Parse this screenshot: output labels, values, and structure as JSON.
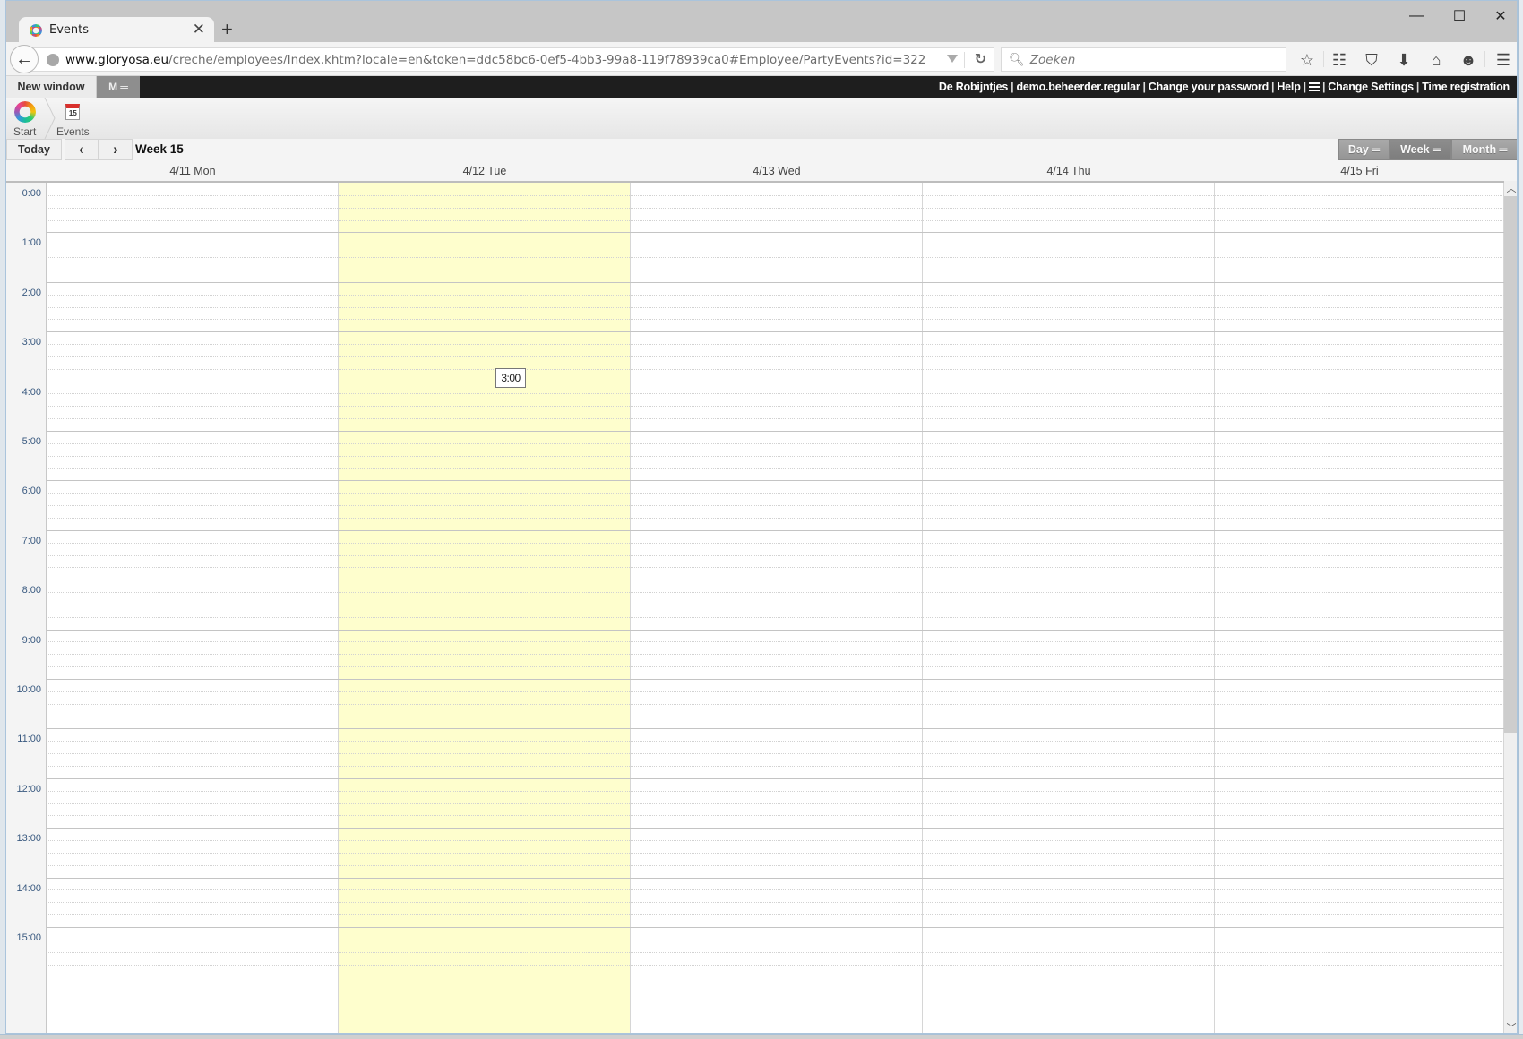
{
  "browser": {
    "tab_title": "Events",
    "url_domain": "www.gloryosa.eu",
    "url_path": "/creche/employees/Index.khtm?locale=en&token=ddc58bc6-0ef5-4bb3-99a8-119f78939ca0#Employee/PartyEvents?id=322",
    "search_placeholder": "Zoeken",
    "toolbar_icons": [
      "star-icon",
      "reading-list-icon",
      "pocket-icon",
      "download-icon",
      "home-icon",
      "smiley-icon",
      "hamburger-menu-icon"
    ]
  },
  "appbar": {
    "new_window_label": "New window",
    "m_label": "M ═",
    "links": {
      "org": "De Robijntjes",
      "user": "demo.beheerder.regular",
      "change_password": "Change your password",
      "help": "Help",
      "change_settings": "Change Settings",
      "time_registration": "Time registration"
    }
  },
  "breadcrumb": {
    "items": [
      {
        "label": "Start",
        "icon": "start-logo-icon"
      },
      {
        "label": "Events",
        "icon": "calendar-icon",
        "icon_text": "15"
      }
    ]
  },
  "calendar": {
    "today_label": "Today",
    "prev_label": "<",
    "next_label": ">",
    "title": "Week 15",
    "views": [
      {
        "label": "Day ═",
        "active": false
      },
      {
        "label": "Week ═",
        "active": true
      },
      {
        "label": "Month ═",
        "active": false
      }
    ],
    "days": [
      {
        "label": "4/11 Mon",
        "today": false
      },
      {
        "label": "4/12 Tue",
        "today": true
      },
      {
        "label": "4/13 Wed",
        "today": false
      },
      {
        "label": "4/14 Thu",
        "today": false
      },
      {
        "label": "4/15 Fri",
        "today": false
      }
    ],
    "hours": [
      "0:00",
      "1:00",
      "2:00",
      "3:00",
      "4:00",
      "5:00",
      "6:00",
      "7:00",
      "8:00",
      "9:00",
      "10:00",
      "11:00",
      "12:00",
      "13:00",
      "14:00",
      "15:00"
    ],
    "hover_tooltip": "3:00",
    "today_color": "#fefecd"
  }
}
